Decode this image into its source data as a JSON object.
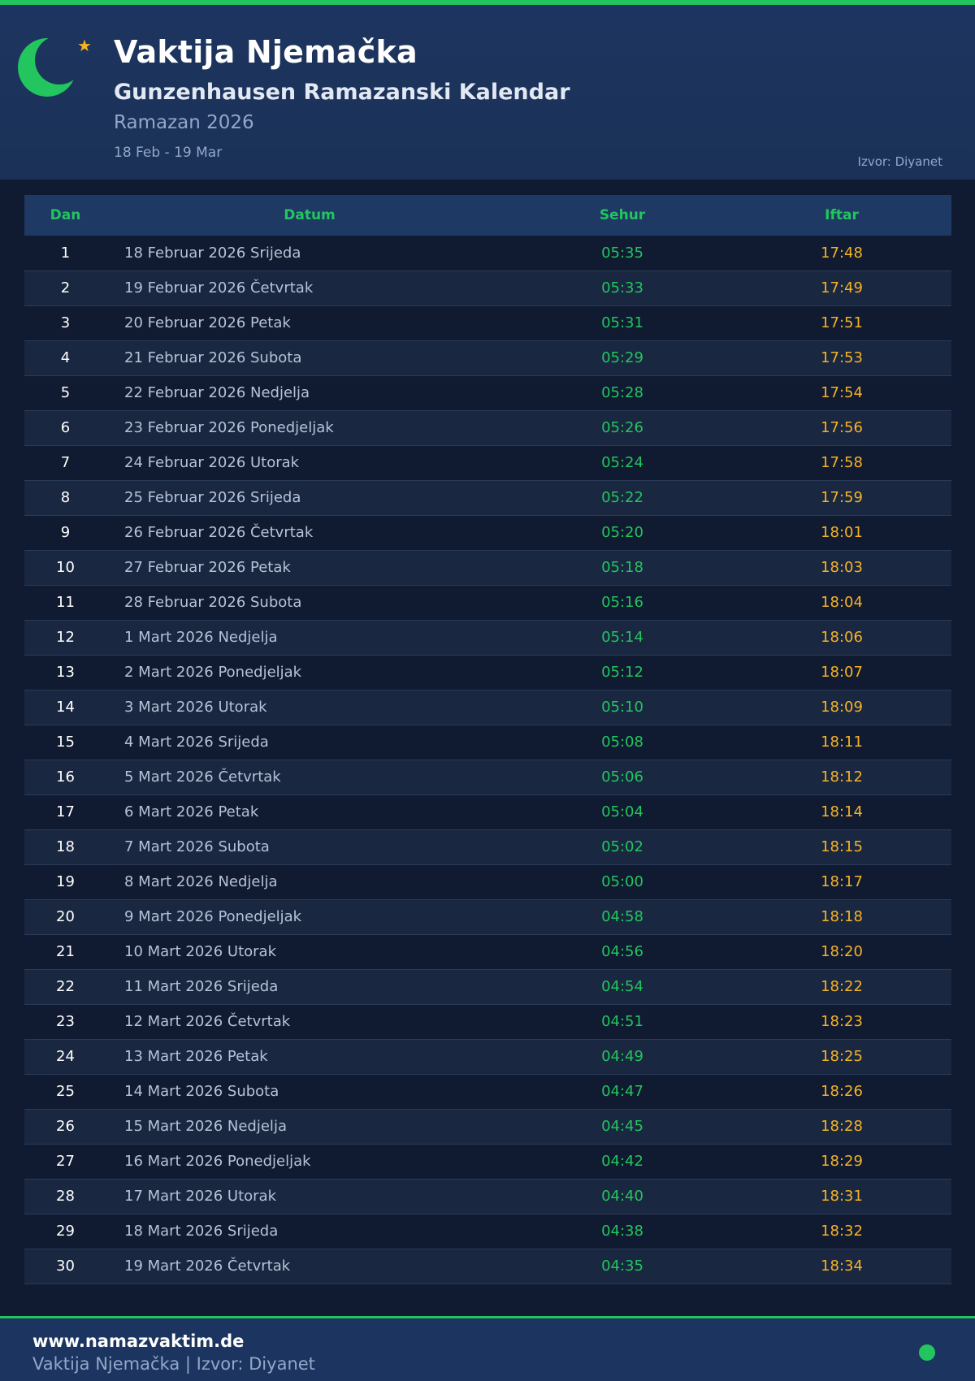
{
  "header": {
    "title": "Vaktija Njemačka",
    "subtitle": "Gunzenhausen Ramazanski Kalendar",
    "ramazan": "Ramazan 2026",
    "range": "18 Feb - 19 Mar",
    "source": "Izvor: Diyanet",
    "icons": [
      "crescent-moon-icon",
      "star-icon"
    ]
  },
  "colors": {
    "accent_green": "#22c55e",
    "iftar_gold": "#f5b324",
    "header_bg": "#1c3560",
    "page_bg": "#101a30"
  },
  "table": {
    "columns": [
      "Dan",
      "Datum",
      "Sehur",
      "Iftar"
    ],
    "rows": [
      {
        "day": "1",
        "date": "18 Februar 2026 Srijeda",
        "sehur": "05:35",
        "iftar": "17:48"
      },
      {
        "day": "2",
        "date": "19 Februar 2026 Četvrtak",
        "sehur": "05:33",
        "iftar": "17:49"
      },
      {
        "day": "3",
        "date": "20 Februar 2026 Petak",
        "sehur": "05:31",
        "iftar": "17:51"
      },
      {
        "day": "4",
        "date": "21 Februar 2026 Subota",
        "sehur": "05:29",
        "iftar": "17:53"
      },
      {
        "day": "5",
        "date": "22 Februar 2026 Nedjelja",
        "sehur": "05:28",
        "iftar": "17:54"
      },
      {
        "day": "6",
        "date": "23 Februar 2026 Ponedjeljak",
        "sehur": "05:26",
        "iftar": "17:56"
      },
      {
        "day": "7",
        "date": "24 Februar 2026 Utorak",
        "sehur": "05:24",
        "iftar": "17:58"
      },
      {
        "day": "8",
        "date": "25 Februar 2026 Srijeda",
        "sehur": "05:22",
        "iftar": "17:59"
      },
      {
        "day": "9",
        "date": "26 Februar 2026 Četvrtak",
        "sehur": "05:20",
        "iftar": "18:01"
      },
      {
        "day": "10",
        "date": "27 Februar 2026 Petak",
        "sehur": "05:18",
        "iftar": "18:03"
      },
      {
        "day": "11",
        "date": "28 Februar 2026 Subota",
        "sehur": "05:16",
        "iftar": "18:04"
      },
      {
        "day": "12",
        "date": "1 Mart 2026 Nedjelja",
        "sehur": "05:14",
        "iftar": "18:06"
      },
      {
        "day": "13",
        "date": "2 Mart 2026 Ponedjeljak",
        "sehur": "05:12",
        "iftar": "18:07"
      },
      {
        "day": "14",
        "date": "3 Mart 2026 Utorak",
        "sehur": "05:10",
        "iftar": "18:09"
      },
      {
        "day": "15",
        "date": "4 Mart 2026 Srijeda",
        "sehur": "05:08",
        "iftar": "18:11"
      },
      {
        "day": "16",
        "date": "5 Mart 2026 Četvrtak",
        "sehur": "05:06",
        "iftar": "18:12"
      },
      {
        "day": "17",
        "date": "6 Mart 2026 Petak",
        "sehur": "05:04",
        "iftar": "18:14"
      },
      {
        "day": "18",
        "date": "7 Mart 2026 Subota",
        "sehur": "05:02",
        "iftar": "18:15"
      },
      {
        "day": "19",
        "date": "8 Mart 2026 Nedjelja",
        "sehur": "05:00",
        "iftar": "18:17"
      },
      {
        "day": "20",
        "date": "9 Mart 2026 Ponedjeljak",
        "sehur": "04:58",
        "iftar": "18:18"
      },
      {
        "day": "21",
        "date": "10 Mart 2026 Utorak",
        "sehur": "04:56",
        "iftar": "18:20"
      },
      {
        "day": "22",
        "date": "11 Mart 2026 Srijeda",
        "sehur": "04:54",
        "iftar": "18:22"
      },
      {
        "day": "23",
        "date": "12 Mart 2026 Četvrtak",
        "sehur": "04:51",
        "iftar": "18:23"
      },
      {
        "day": "24",
        "date": "13 Mart 2026 Petak",
        "sehur": "04:49",
        "iftar": "18:25"
      },
      {
        "day": "25",
        "date": "14 Mart 2026 Subota",
        "sehur": "04:47",
        "iftar": "18:26"
      },
      {
        "day": "26",
        "date": "15 Mart 2026 Nedjelja",
        "sehur": "04:45",
        "iftar": "18:28"
      },
      {
        "day": "27",
        "date": "16 Mart 2026 Ponedjeljak",
        "sehur": "04:42",
        "iftar": "18:29"
      },
      {
        "day": "28",
        "date": "17 Mart 2026 Utorak",
        "sehur": "04:40",
        "iftar": "18:31"
      },
      {
        "day": "29",
        "date": "18 Mart 2026 Srijeda",
        "sehur": "04:38",
        "iftar": "18:32"
      },
      {
        "day": "30",
        "date": "19 Mart 2026 Četvrtak",
        "sehur": "04:35",
        "iftar": "18:34"
      }
    ]
  },
  "footer": {
    "site": "www.namazvaktim.de",
    "subtitle": "Vaktija Njemačka | Izvor: Diyanet"
  }
}
